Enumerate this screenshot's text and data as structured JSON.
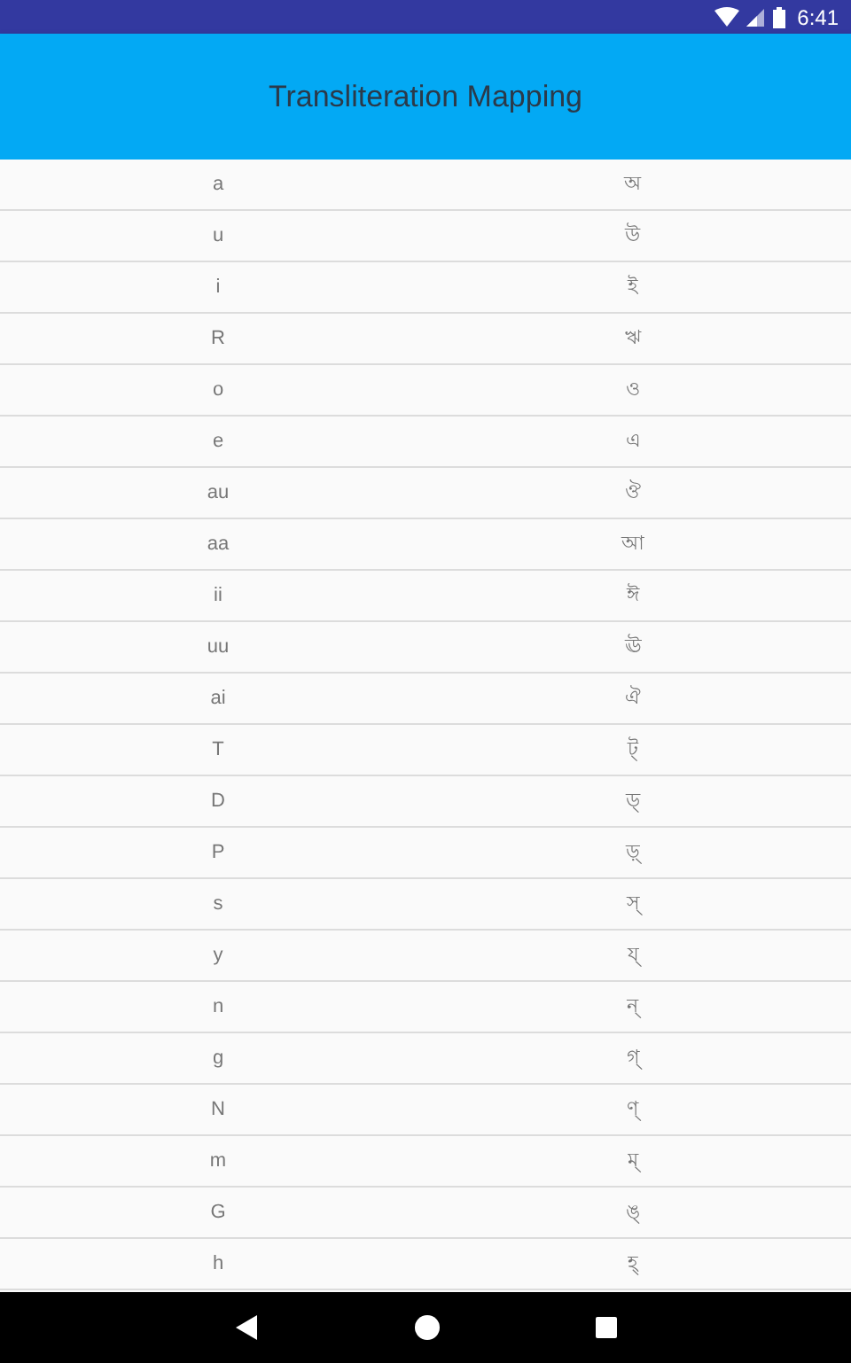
{
  "status_bar": {
    "time": "6:41"
  },
  "toolbar": {
    "title": "Transliteration Mapping"
  },
  "rows": [
    {
      "latin": "a",
      "bengali": "অ"
    },
    {
      "latin": "u",
      "bengali": "উ"
    },
    {
      "latin": "i",
      "bengali": "ই"
    },
    {
      "latin": "R",
      "bengali": "ঋ"
    },
    {
      "latin": "o",
      "bengali": "ও"
    },
    {
      "latin": "e",
      "bengali": "এ"
    },
    {
      "latin": "au",
      "bengali": "ঔ"
    },
    {
      "latin": "aa",
      "bengali": "আ"
    },
    {
      "latin": "ii",
      "bengali": "ঈ"
    },
    {
      "latin": "uu",
      "bengali": "ঊ"
    },
    {
      "latin": "ai",
      "bengali": "ঐ"
    },
    {
      "latin": "T",
      "bengali": "ট্"
    },
    {
      "latin": "D",
      "bengali": "ড্"
    },
    {
      "latin": "P",
      "bengali": "ড়্"
    },
    {
      "latin": "s",
      "bengali": "স্"
    },
    {
      "latin": "y",
      "bengali": "য্"
    },
    {
      "latin": "n",
      "bengali": "ন্"
    },
    {
      "latin": "g",
      "bengali": "গ্"
    },
    {
      "latin": "N",
      "bengali": "ণ্"
    },
    {
      "latin": "m",
      "bengali": "ম্"
    },
    {
      "latin": "G",
      "bengali": "ঙ্"
    },
    {
      "latin": "h",
      "bengali": "হ্"
    }
  ]
}
